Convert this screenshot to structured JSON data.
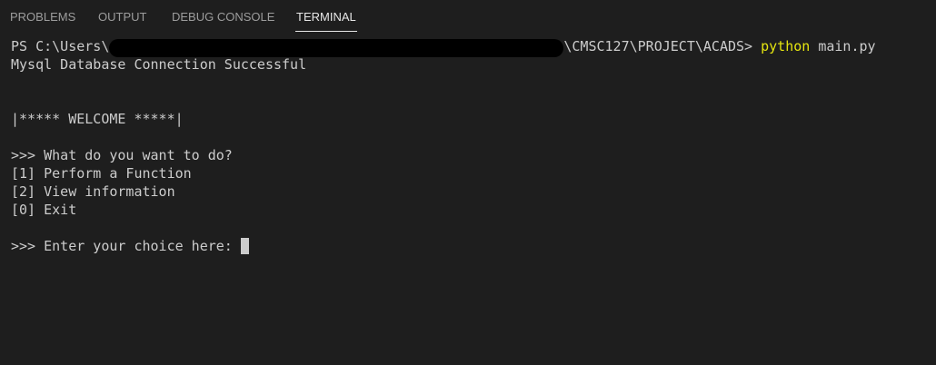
{
  "tabs": [
    {
      "label": "PROBLEMS"
    },
    {
      "label": "OUTPUT"
    },
    {
      "label": "DEBUG CONSOLE"
    },
    {
      "label": "TERMINAL",
      "active": true
    }
  ],
  "terminal": {
    "prompt_prefix": "PS C:\\Users\\",
    "prompt_suffix": "\\CMSC127\\PROJECT\\ACADS> ",
    "command_name": "python",
    "command_args": " main.py",
    "db_status": "Mysql Database Connection Successful",
    "welcome": "|***** WELCOME *****|",
    "question": ">>> What do you want to do?",
    "option_1": "[1] Perform a Function",
    "option_2": "[2] View information",
    "option_0": "[0] Exit",
    "choice_prompt": ">>> Enter your choice here: "
  },
  "colors": {
    "background": "#1e1e1e",
    "text": "#cccccc",
    "command_highlight": "#e5e510",
    "redaction": "#000000"
  }
}
